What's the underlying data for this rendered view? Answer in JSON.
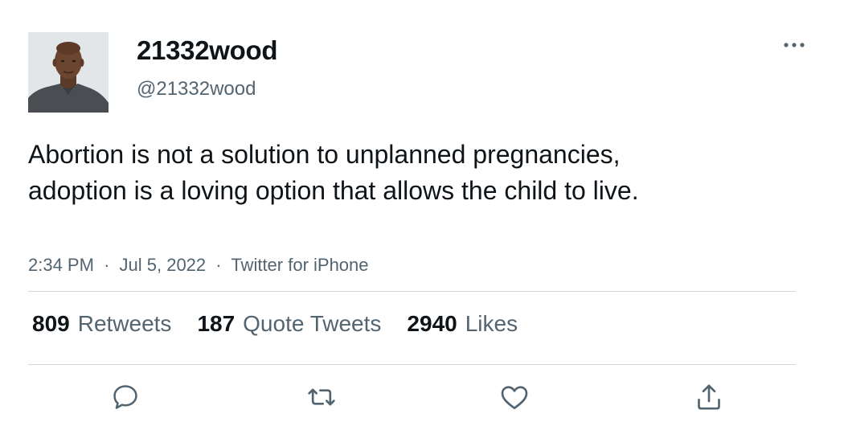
{
  "author": {
    "display_name": "21332wood",
    "handle": "@21332wood"
  },
  "tweet": {
    "text": "Abortion is not a solution to unplanned pregnancies, adoption is a loving option that allows the child to live.",
    "time": "2:34 PM",
    "date": "Jul 5, 2022",
    "source": "Twitter for iPhone",
    "separator": "·"
  },
  "stats": {
    "retweets": {
      "count": "809",
      "label": "Retweets"
    },
    "quote_tweets": {
      "count": "187",
      "label": "Quote Tweets"
    },
    "likes": {
      "count": "2940",
      "label": "Likes"
    }
  },
  "icons": {
    "more": "more-horizontal-icon",
    "reply": "reply-icon",
    "retweet": "retweet-icon",
    "like": "heart-icon",
    "share": "share-icon"
  },
  "colors": {
    "text_primary": "#0f1419",
    "text_secondary": "#536471",
    "divider": "#cfd9de"
  }
}
